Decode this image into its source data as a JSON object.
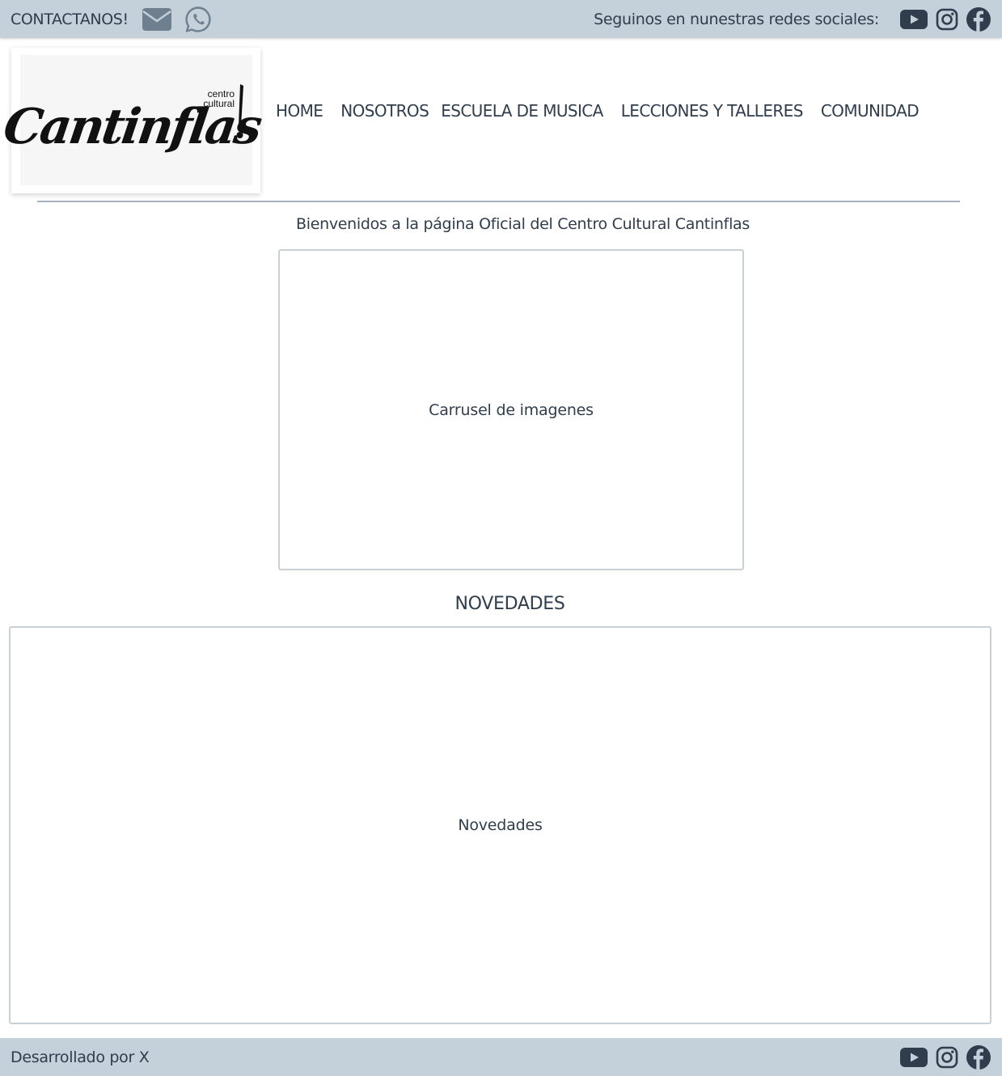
{
  "topbar": {
    "contact_label": "CONTACTANOS!",
    "contact_icons": [
      "envelope-icon",
      "whatsapp-icon"
    ],
    "follow_label": "Seguinos en nunestras redes sociales:",
    "social_icons": [
      "youtube-icon",
      "instagram-icon",
      "facebook-icon"
    ]
  },
  "header": {
    "logo": {
      "script_text": "Cantinflas",
      "small_text_line1": "centro",
      "small_text_line2": "cultural"
    },
    "nav": [
      "HOME",
      "NOSOTROS",
      "ESCUELA DE MUSICA",
      "LECCIONES Y TALLERES",
      "COMUNIDAD"
    ]
  },
  "main": {
    "welcome": "Bienvenidos a la página Oficial del Centro Cultural Cantinflas",
    "carousel_label": "Carrusel de imagenes",
    "news_title": "NOVEDADES",
    "news_label": "Novedades"
  },
  "footer": {
    "credit": "Desarrollado por X",
    "social_icons": [
      "youtube-icon",
      "instagram-icon",
      "facebook-icon"
    ]
  },
  "colors": {
    "bar_background": "#c4d0da",
    "text": "#2f3d4c",
    "icon": "#2f3d4c",
    "muted_icon": "#6e7f90",
    "border": "#c9d1d8",
    "divider": "#a6b3bf"
  }
}
